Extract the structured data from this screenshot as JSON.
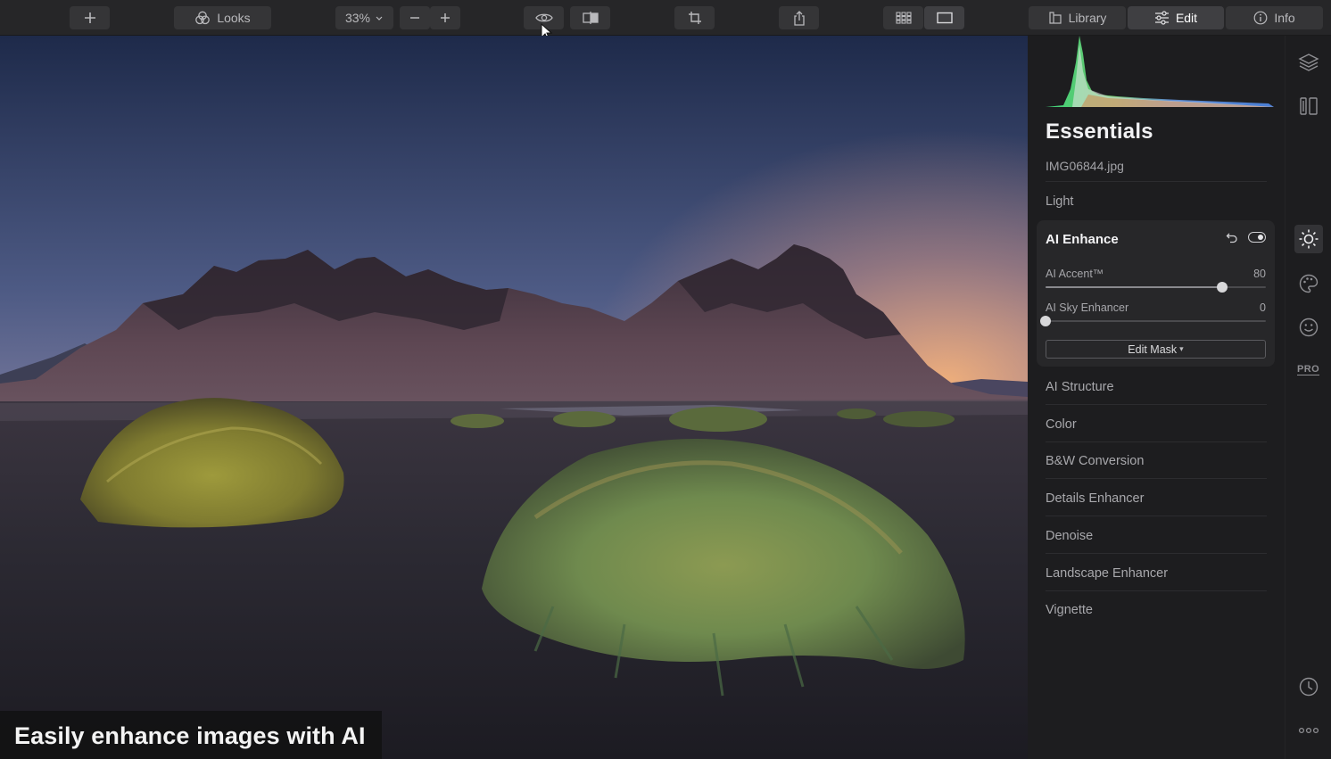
{
  "toolbar": {
    "looks_label": "Looks",
    "zoom_value": "33%",
    "library_label": "Library",
    "edit_label": "Edit",
    "info_label": "Info",
    "icons": [
      "add-icon",
      "looks-icon",
      "zoom-out-icon",
      "zoom-in-icon",
      "preview-eye-icon",
      "compare-icon",
      "crop-icon",
      "share-icon",
      "grid-view-icon",
      "single-view-icon",
      "library-icon",
      "sliders-icon",
      "info-icon"
    ]
  },
  "canvas": {
    "caption": "Easily enhance images with AI"
  },
  "panel": {
    "title": "Essentials",
    "filename": "IMG06844.jpg",
    "light_label": "Light",
    "ai_enhance": {
      "title": "AI Enhance",
      "sliders": [
        {
          "label": "AI Accent™",
          "value": 80,
          "fraction": 0.8
        },
        {
          "label": "AI Sky Enhancer",
          "value": 0,
          "fraction": 0.0
        }
      ],
      "edit_mask_label": "Edit Mask"
    },
    "sections": [
      "AI Structure",
      "Color",
      "B&W Conversion",
      "Details Enhancer",
      "Denoise",
      "Landscape Enhancer",
      "Vignette"
    ]
  },
  "iconbar": {
    "pro_label": "PRO",
    "icons": [
      "layers-icon",
      "presets-icon",
      "essentials-sun-icon",
      "creative-palette-icon",
      "portrait-face-icon",
      "pro-icon",
      "history-clock-icon",
      "more-icon"
    ]
  },
  "colors": {
    "accent_bg": "#272729",
    "toolbar_bg": "#262628",
    "panel_bg": "#1d1d1f"
  }
}
